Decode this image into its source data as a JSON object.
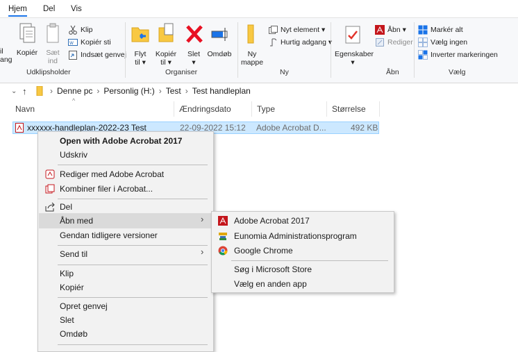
{
  "tabs": [
    {
      "label": "Hjem"
    },
    {
      "label": "Del"
    },
    {
      "label": "Vis"
    }
  ],
  "ribbon": {
    "cut_edge1": "il",
    "cut_edge2": "ang",
    "kopier": "Kopiér",
    "saet1": "Sæt",
    "saet2": "ind",
    "klip": "Klip",
    "kopier_sti": "Kopiér sti",
    "indsaet_genvej": "Indsæt genvej",
    "udklipsholder": "Udklipsholder",
    "flyt1": "Flyt",
    "flyt2": "til ▾",
    "kopier_til1": "Kopiér",
    "kopier_til2": "til ▾",
    "slet1": "Slet",
    "slet2": "▾",
    "omdob": "Omdøb",
    "organiser": "Organiser",
    "ny1": "Ny",
    "ny2": "mappe",
    "nyt_element": "Nyt element ▾",
    "hurtig_adgang": "Hurtig adgang ▾",
    "ny_group": "Ny",
    "egenskaber1": "Egenskaber",
    "egenskaber2": "▾",
    "abn": "Åbn ▾",
    "rediger": "Rediger",
    "abn_group": "Åbn",
    "marker_alt": "Markér alt",
    "vaelg_ingen": "Vælg ingen",
    "inverter": "Inverter markeringen",
    "vaelg_group": "Vælg"
  },
  "address": {
    "path": [
      "Denne pc",
      "Personlig (H:)",
      "Test",
      "Test handleplan"
    ]
  },
  "columns": {
    "navn": "Navn",
    "dato": "Ændringsdato",
    "type": "Type",
    "storrelse": "Størrelse"
  },
  "file": {
    "name": "xxxxxx-handleplan-2022-23 Test",
    "date": "22-09-2022 15:12",
    "type": "Adobe Acrobat D...",
    "size": "492 KB"
  },
  "context_menu": {
    "open_with_acrobat": "Open with Adobe Acrobat 2017",
    "udskriv": "Udskriv",
    "rediger_acrobat": "Rediger med Adobe Acrobat",
    "kombiner": "Kombiner filer i Acrobat...",
    "del": "Del",
    "abn_med": "Åbn med",
    "gendan": "Gendan tidligere versioner",
    "send_til": "Send til",
    "klip": "Klip",
    "kopier": "Kopiér",
    "opret_genvej": "Opret genvej",
    "slet": "Slet",
    "omdob": "Omdøb"
  },
  "submenu": {
    "acrobat": "Adobe Acrobat 2017",
    "eunomia": "Eunomia Administrationsprogram",
    "chrome": "Google Chrome",
    "store": "Søg i Microsoft Store",
    "anden_app": "Vælg en anden app"
  },
  "colors": {
    "accent": "#1a73e8",
    "selection": "#cce8ff",
    "acrobat_red": "#c4161c",
    "delete_red": "#e81123",
    "folder_yellow": "#f8c842"
  }
}
